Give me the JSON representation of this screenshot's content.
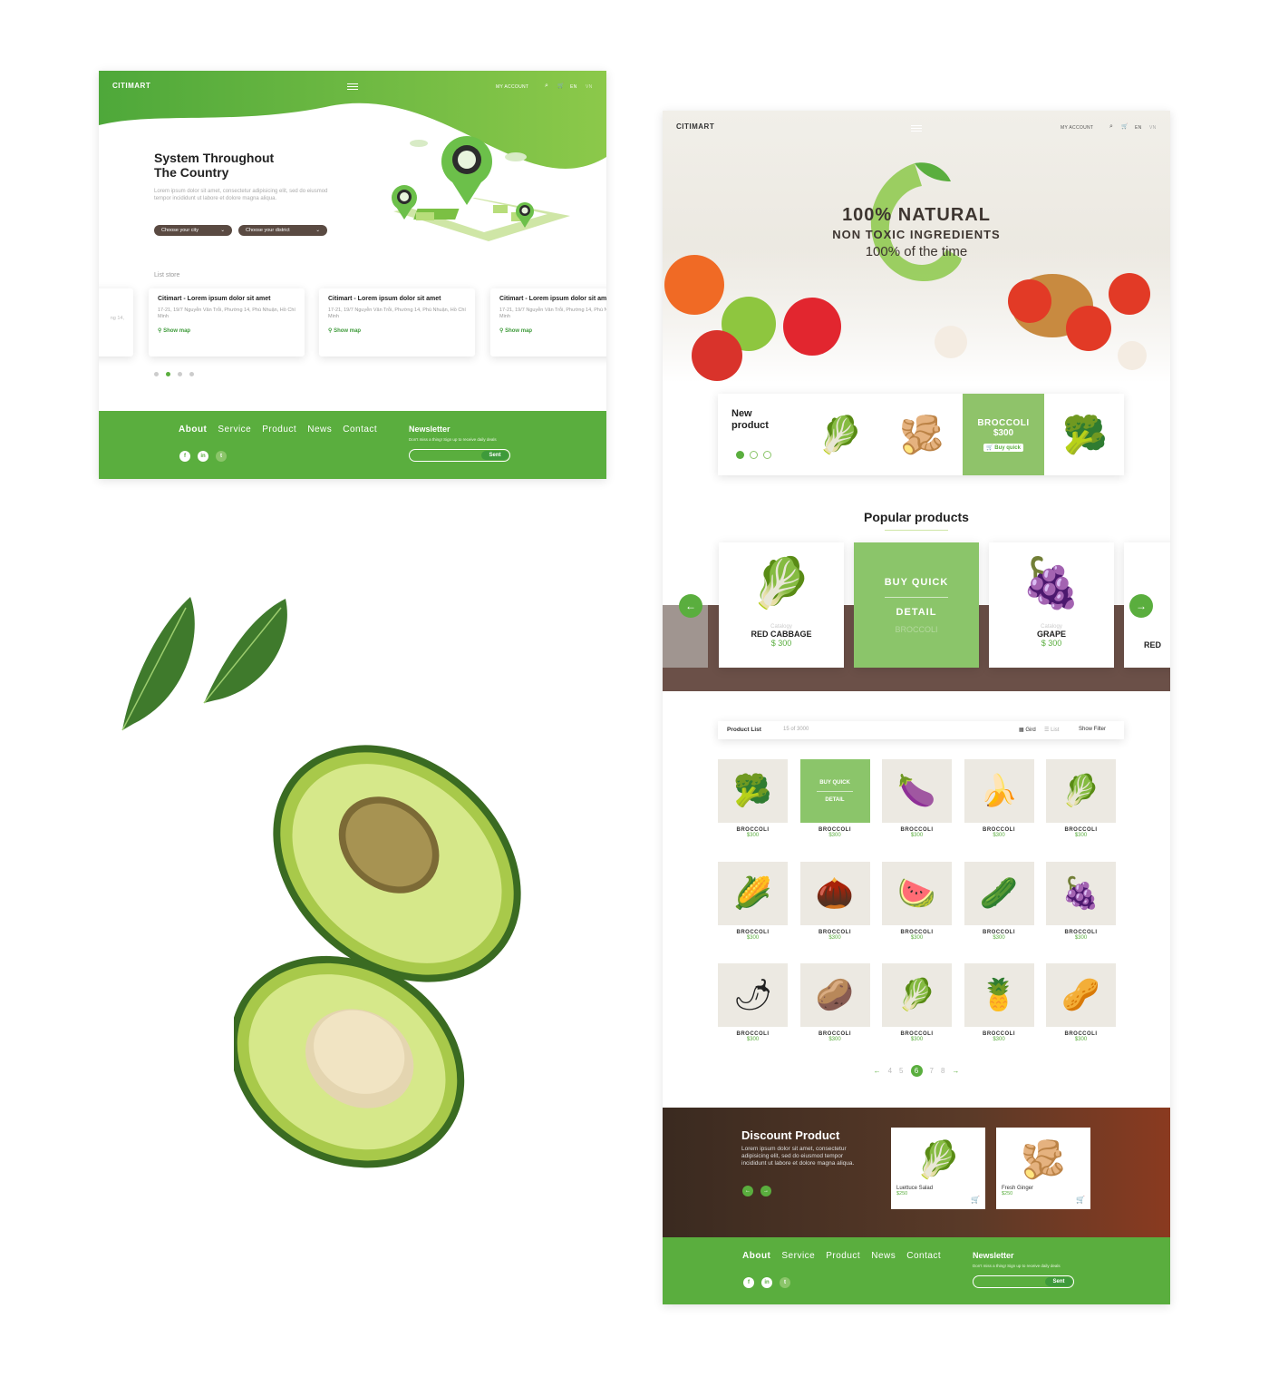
{
  "left_page": {
    "logo": "CITIMART",
    "nav": {
      "account": "MY ACCOUNT",
      "lang_en": "EN",
      "lang_vn": "VN"
    },
    "hero_title_line1": "System Throughout",
    "hero_title_line2": "The Country",
    "hero_lorem": "Lorem ipsum dolor sit amet, consectetur adipisicing elit, sed do eiusmod tempor incididunt ut labore et dolore magna aliqua.",
    "select_city": "Choose your city",
    "select_district": "Choose your district",
    "list_store_label": "List store",
    "stores": [
      {
        "title": "Citimart - Lorem ipsum dolor sit amet",
        "address": "17-21, 19/7 Nguyễn Văn Trỗi, Phường 14, Phú Nhuận, Hồ Chí Minh",
        "map": "Show map"
      },
      {
        "title": "Citimart - Lorem ipsum dolor sit amet",
        "address": "17-21, 19/7 Nguyễn Văn Trỗi, Phường 14, Phú Nhuận, Hồ Chí Minh",
        "map": "Show map"
      },
      {
        "title": "Citimart - Lorem ipsum dolor sit amet",
        "address": "17-21, 19/7 Nguyễn Văn Trỗi, Phường 14, Phú Nhuận, Hồ Chí Minh",
        "map": "Show map"
      }
    ],
    "partial_store_text": "ng 14,"
  },
  "footer": {
    "menu": [
      "About",
      "Service",
      "Product",
      "News",
      "Contact"
    ],
    "social": [
      "f",
      "in",
      "t"
    ],
    "newsletter_title": "Newsletter",
    "newsletter_sub": "Don't miss a thing! Sign up to receive daily deals",
    "send": "Sent"
  },
  "right_page": {
    "logo": "CITIMART",
    "nav": {
      "account": "MY ACCOUNT",
      "lang_en": "EN",
      "lang_vn": "VN"
    },
    "hero_line1": "100% NATURAL",
    "hero_line2": "NON TOXIC INGREDIENTS",
    "hero_line3": "100% of the time",
    "new_product": {
      "label_line1": "New",
      "label_line2": "product",
      "highlight_name": "BROCCOLI",
      "highlight_price": "$300",
      "buy_quick": "Buy quick",
      "items": [
        "🥬",
        "🫚",
        "🥦",
        "🥦"
      ]
    },
    "popular_title": "Popular products",
    "popular": [
      {
        "category": "Catalogy",
        "name": "RED CABBAGE",
        "price": "$ 300",
        "icon": "🥬"
      },
      {
        "category": "",
        "name": "BROCCOLI",
        "price": "",
        "icon": ""
      },
      {
        "category": "Catalogy",
        "name": "GRAPE",
        "price": "$ 300",
        "icon": "🍇"
      }
    ],
    "popular_hl": {
      "buy": "BUY QUICK",
      "detail": "DETAIL"
    },
    "partial_red": "RED",
    "product_list": {
      "title": "Product List",
      "count": "15 of 3000",
      "grid": "Gird",
      "list": "List",
      "filter": "Show Filter"
    },
    "grid_hl": {
      "buy": "BUY QUICK",
      "detail": "DETAIL"
    },
    "products": [
      {
        "name": "BROCCOLI",
        "price": "$300",
        "icon": "🥦"
      },
      {
        "name": "BROCCOLI",
        "price": "$300",
        "icon": ""
      },
      {
        "name": "BROCCOLI",
        "price": "$300",
        "icon": "🍆"
      },
      {
        "name": "BROCCOLI",
        "price": "$300",
        "icon": "🍌"
      },
      {
        "name": "BROCCOLI",
        "price": "$300",
        "icon": "🥬"
      },
      {
        "name": "BROCCOLI",
        "price": "$300",
        "icon": "🌽"
      },
      {
        "name": "BROCCOLI",
        "price": "$300",
        "icon": "🌰"
      },
      {
        "name": "BROCCOLI",
        "price": "$300",
        "icon": "🍉"
      },
      {
        "name": "BROCCOLI",
        "price": "$300",
        "icon": "🥒"
      },
      {
        "name": "BROCCOLI",
        "price": "$300",
        "icon": "🍇"
      },
      {
        "name": "BROCCOLI",
        "price": "$300",
        "icon": "🌶"
      },
      {
        "name": "BROCCOLI",
        "price": "$300",
        "icon": "🥔"
      },
      {
        "name": "BROCCOLI",
        "price": "$300",
        "icon": "🥬"
      },
      {
        "name": "BROCCOLI",
        "price": "$300",
        "icon": "🍍"
      },
      {
        "name": "BROCCOLI",
        "price": "$300",
        "icon": "🥜"
      }
    ],
    "pagination": [
      "4",
      "5",
      "6",
      "7",
      "8"
    ],
    "current_page": "6",
    "discount": {
      "title": "Discount Product",
      "lorem": "Lorem ipsum dolor sit amet, consectetur adipisicing elit, sed do eiusmod tempor incididunt ut labore et dolore magna aliqua.",
      "items": [
        {
          "name": "Luettuce Salad",
          "price": "$250",
          "icon": "🥬"
        },
        {
          "name": "Fresh Ginger",
          "price": "$250",
          "icon": "🫚"
        }
      ]
    }
  },
  "colors": {
    "brand_green": "#5aae3e",
    "light_green": "#8bc56a",
    "dark_brown": "#5a4a42"
  }
}
